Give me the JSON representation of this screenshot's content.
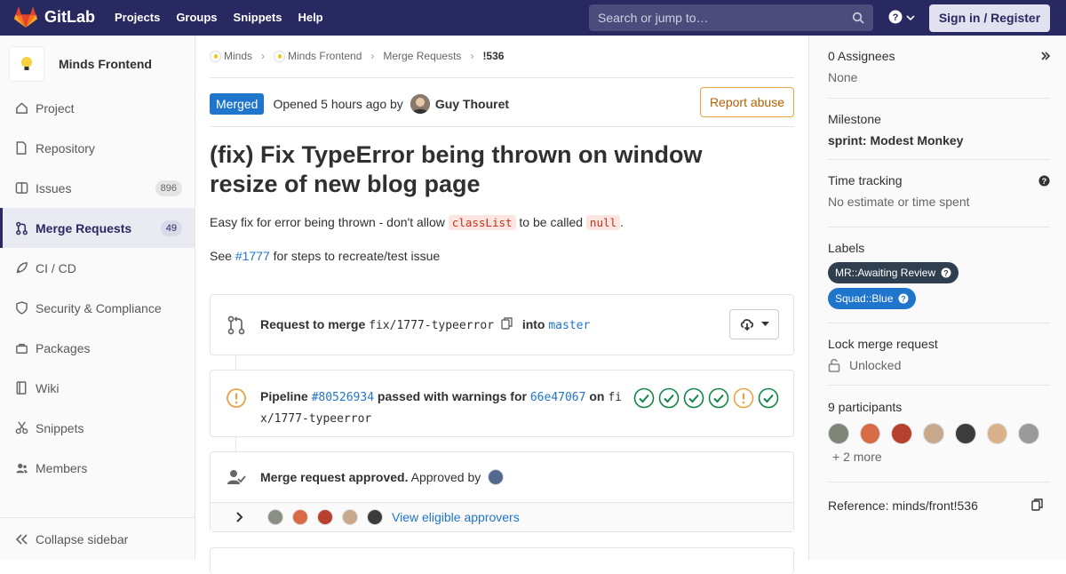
{
  "topnav": {
    "brand": "GitLab",
    "links": [
      "Projects",
      "Groups",
      "Snippets",
      "Help"
    ],
    "search_placeholder": "Search or jump to…",
    "signin": "Sign in / Register"
  },
  "sidebar": {
    "project_name": "Minds Frontend",
    "items": [
      {
        "label": "Project",
        "icon": "home-icon"
      },
      {
        "label": "Repository",
        "icon": "doc-icon"
      },
      {
        "label": "Issues",
        "icon": "issues-icon",
        "count": "896"
      },
      {
        "label": "Merge Requests",
        "icon": "merge-request-icon",
        "count": "49"
      },
      {
        "label": "CI / CD",
        "icon": "rocket-icon"
      },
      {
        "label": "Security & Compliance",
        "icon": "shield-icon"
      },
      {
        "label": "Packages",
        "icon": "package-icon"
      },
      {
        "label": "Wiki",
        "icon": "book-icon"
      },
      {
        "label": "Snippets",
        "icon": "scissors-icon"
      },
      {
        "label": "Members",
        "icon": "users-icon"
      }
    ],
    "collapse": "Collapse sidebar"
  },
  "breadcrumb": [
    "Minds",
    "Minds Frontend",
    "Merge Requests",
    "!536"
  ],
  "mr": {
    "status": "Merged",
    "opened_text": "Opened 5 hours ago by",
    "author": "Guy Thouret",
    "report": "Report abuse",
    "title": "(fix) Fix TypeError being thrown on window resize of new blog page",
    "desc": {
      "part1": "Easy fix for error being thrown - don't allow ",
      "code1": "classList",
      "part2": " to be called ",
      "code2": "null",
      "part3": "."
    },
    "see": {
      "part1": "See ",
      "link": "#1777",
      "part2": " for steps to recreate/test issue"
    }
  },
  "widget": {
    "request_label": "Request to merge",
    "source_branch": "fix/1777-typeerror",
    "into": "into",
    "target_branch": "master"
  },
  "pipeline": {
    "label": "Pipeline",
    "id": "#80526934",
    "status_text": "passed with warnings for",
    "commit": "66e47067",
    "on": "on",
    "branch_line1": "fi",
    "branch_line2": "x/1777-typeerror",
    "stages": [
      "passed",
      "passed",
      "passed",
      "passed",
      "warning",
      "passed"
    ]
  },
  "approval": {
    "title": "Merge request approved.",
    "by": "Approved by",
    "eligible_link": "View eligible approvers"
  },
  "right": {
    "assignees_title": "0 Assignees",
    "assignees_value": "None",
    "milestone_title": "Milestone",
    "milestone_value": "sprint: Modest Monkey",
    "time_title": "Time tracking",
    "time_value": "No estimate or time spent",
    "labels_title": "Labels",
    "labels": [
      {
        "text": "MR::Awaiting Review",
        "color": "#303f4f"
      },
      {
        "text": "Squad::Blue",
        "color": "#1f75cb"
      }
    ],
    "lock_title": "Lock merge request",
    "lock_value": "Unlocked",
    "participants_title": "9 participants",
    "more": "+ 2 more",
    "reference": "Reference: minds/front!536"
  }
}
